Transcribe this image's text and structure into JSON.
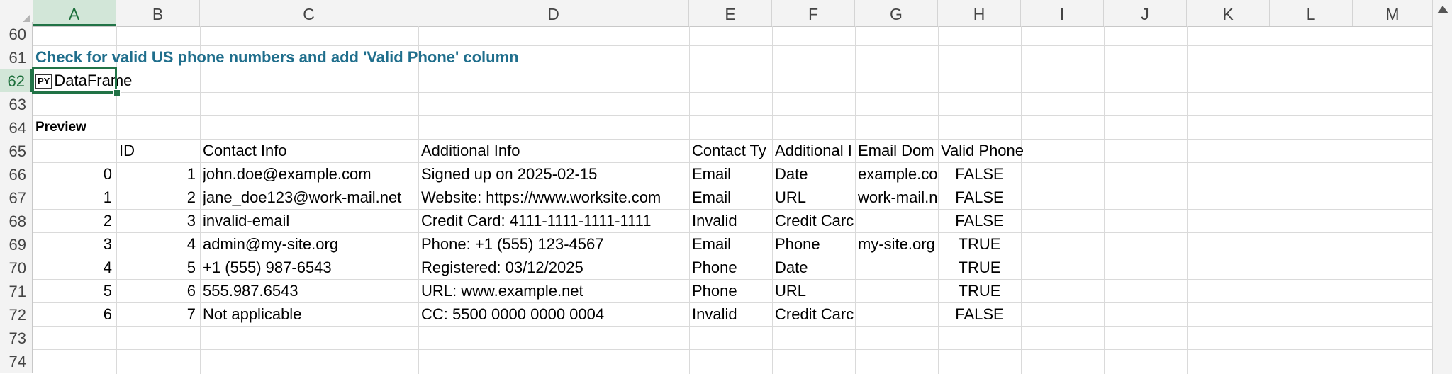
{
  "columns": [
    "A",
    "B",
    "C",
    "D",
    "E",
    "F",
    "G",
    "H",
    "I",
    "J",
    "K",
    "L",
    "M"
  ],
  "rows": [
    "60",
    "61",
    "62",
    "63",
    "64",
    "65",
    "66",
    "67",
    "68",
    "69",
    "70",
    "71",
    "72",
    "73",
    "74"
  ],
  "title": "Check for valid US phone numbers and add 'Valid Phone' column",
  "selected_cell": {
    "label": "DataFrame",
    "icon": "PY"
  },
  "preview_label": "Preview",
  "table": {
    "headers": [
      "ID",
      "Contact Info",
      "Additional Info",
      "Contact Ty",
      "Additional I",
      "Email Dom",
      "Valid Phone"
    ],
    "rows": [
      {
        "index": "0",
        "id": "1",
        "contact": "john.doe@example.com",
        "info": "Signed up on 2025-02-15",
        "type": "Email",
        "add": "Date",
        "domain": "example.co",
        "valid": "FALSE"
      },
      {
        "index": "1",
        "id": "2",
        "contact": "jane_doe123@work-mail.net",
        "info": "Website: https://www.worksite.com",
        "type": "Email",
        "add": "URL",
        "domain": "work-mail.n",
        "valid": "FALSE"
      },
      {
        "index": "2",
        "id": "3",
        "contact": "invalid-email",
        "info": "Credit Card: 4111-1111-1111-1111",
        "type": "Invalid",
        "add": "Credit Carc",
        "domain": "",
        "valid": "FALSE"
      },
      {
        "index": "3",
        "id": "4",
        "contact": "admin@my-site.org",
        "info": "Phone: +1 (555) 123-4567",
        "type": "Email",
        "add": "Phone",
        "domain": "my-site.org",
        "valid": "TRUE"
      },
      {
        "index": "4",
        "id": "5",
        "contact": "+1 (555) 987-6543",
        "info": "Registered: 03/12/2025",
        "type": "Phone",
        "add": "Date",
        "domain": "",
        "valid": "TRUE"
      },
      {
        "index": "5",
        "id": "6",
        "contact": "555.987.6543",
        "info": "URL: www.example.net",
        "type": "Phone",
        "add": "URL",
        "domain": "",
        "valid": "TRUE"
      },
      {
        "index": "6",
        "id": "7",
        "contact": "Not applicable",
        "info": "CC: 5500 0000 0000 0004",
        "type": "Invalid",
        "add": "Credit Carc",
        "domain": "",
        "valid": "FALSE"
      }
    ]
  }
}
